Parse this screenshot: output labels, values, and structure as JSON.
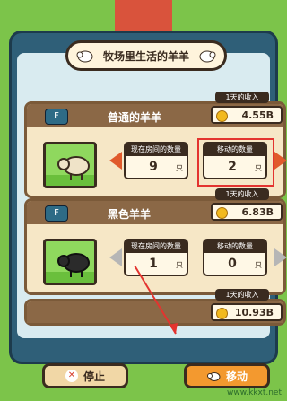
{
  "title": "牧场里生活的羊羊",
  "cards": [
    {
      "badge": "F",
      "name": "普通的羊羊",
      "income_label": "1天的收入",
      "income_value": "4.55B",
      "here_label": "现在房间的数量",
      "here_value": "9",
      "move_label": "移动的数量",
      "move_value": "2",
      "unit": "只"
    },
    {
      "badge": "F",
      "name": "黑色羊羊",
      "income_label": "1天的收入",
      "income_value": "6.83B",
      "here_label": "现在房间的数量",
      "here_value": "1",
      "move_label": "移动的数量",
      "move_value": "0",
      "unit": "只"
    },
    {
      "income_label": "1天的收入",
      "income_value": "10.93B"
    }
  ],
  "buttons": {
    "stop": "停止",
    "move": "移动"
  },
  "colors": {
    "accent": "#f3992f",
    "arrow": "#e05a2c",
    "highlight": "#e3342f",
    "frame": "#2f5f78"
  },
  "footer": "www.kkxt.net"
}
